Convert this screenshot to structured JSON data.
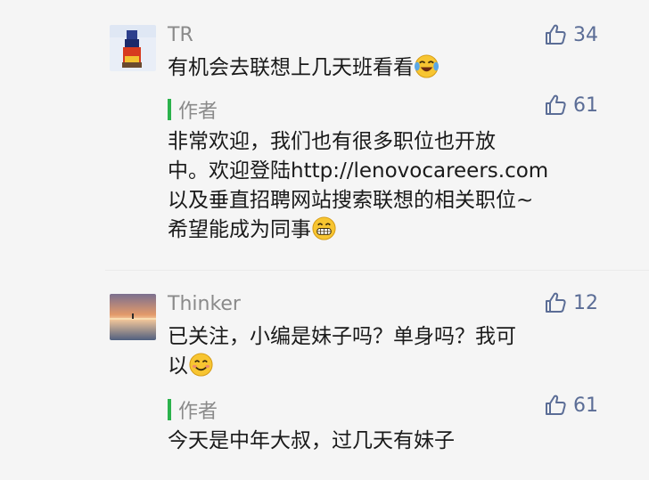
{
  "comments": [
    {
      "name": "TR",
      "likes": "34",
      "text": "有机会去联想上几天班看看",
      "emoji": "laughing-tears-emoji",
      "reply": {
        "author_label": "作者",
        "likes": "61",
        "lines": [
          "非常欢迎，我们也有很多职位也开放",
          "中。欢迎登陆http://lenovocareers.com",
          "以及垂直招聘网站搜索联想的相关职位~",
          "希望能成为同事"
        ],
        "emoji": "grinning-emoji"
      }
    },
    {
      "name": "Thinker",
      "likes": "12",
      "lines": [
        "已关注，小编是妹子吗？单身吗？我可",
        "以"
      ],
      "emoji": "smiling-emoji",
      "reply": {
        "author_label": "作者",
        "likes": "61",
        "text": "今天是中年大叔，过几天有妹子"
      }
    }
  ],
  "colors": {
    "background": "#f5f5f5",
    "name": "#8a8a8a",
    "like": "#5b6d96",
    "author_bar": "#2bb24c",
    "text": "#1a1a1a"
  }
}
